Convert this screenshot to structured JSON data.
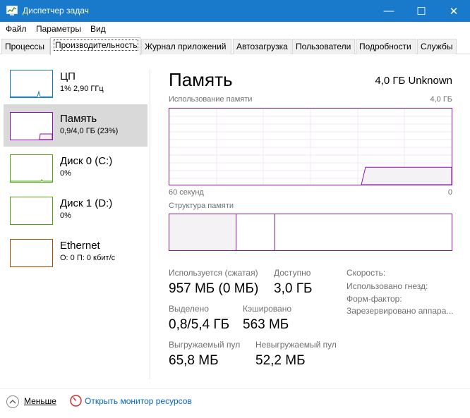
{
  "window": {
    "title": "Диспетчер задач",
    "minimize_glyph": "—",
    "maximize_glyph": "☐",
    "close_glyph": "✕"
  },
  "menu": [
    "Файл",
    "Параметры",
    "Вид"
  ],
  "tabs": [
    "Процессы",
    "Производительность",
    "Журнал приложений",
    "Автозагрузка",
    "Пользователи",
    "Подробности",
    "Службы"
  ],
  "active_tab": "Производительность",
  "devices": [
    {
      "name": "ЦП",
      "detail": "1% 2,90 ГГц",
      "color": "#117dbb",
      "selected": false
    },
    {
      "name": "Память",
      "detail": "0,9/4,0 ГБ (23%)",
      "color": "#8b12ae",
      "selected": true
    },
    {
      "name": "Диск 0 (C:)",
      "detail": "0%",
      "color": "#4da60c",
      "selected": false
    },
    {
      "name": "Диск 1 (D:)",
      "detail": "0%",
      "color": "#4da60c",
      "selected": false
    },
    {
      "name": "Ethernet",
      "detail": "О: 0 П: 0 кбит/с",
      "color": "#a74f01",
      "selected": false
    }
  ],
  "memory": {
    "title": "Память",
    "total": "4,0 ГБ Unknown",
    "usage_label": "Использование памяти",
    "usage_max": "4,0 ГБ",
    "time_left": "60 секунд",
    "time_right": "0",
    "composition_label": "Структура памяти",
    "usage_fraction": 0.23,
    "stats": {
      "in_use_label": "Используется (сжатая)",
      "in_use_value": "957 МБ (0 МБ)",
      "available_label": "Доступно",
      "available_value": "3,0 ГБ",
      "committed_label": "Выделено",
      "committed_value": "0,8/5,4 ГБ",
      "cached_label": "Кэшировано",
      "cached_value": "563 МБ",
      "paged_label": "Выгружаемый пул",
      "paged_value": "65,8 МБ",
      "nonpaged_label": "Невыгружаемый пул",
      "nonpaged_value": "52,2 МБ"
    },
    "properties": [
      "Скорость:",
      "Использовано гнезд:",
      "Форм-фактор:",
      "Зарезервировано аппара..."
    ]
  },
  "bottom": {
    "fewer_details": "Меньше",
    "resource_monitor": "Открыть монитор ресурсов"
  },
  "colors": {
    "titlebar": "#1979ca",
    "memory": "#8b12ae",
    "cpu": "#117dbb",
    "disk": "#4da60c",
    "ethernet": "#a74f01"
  }
}
